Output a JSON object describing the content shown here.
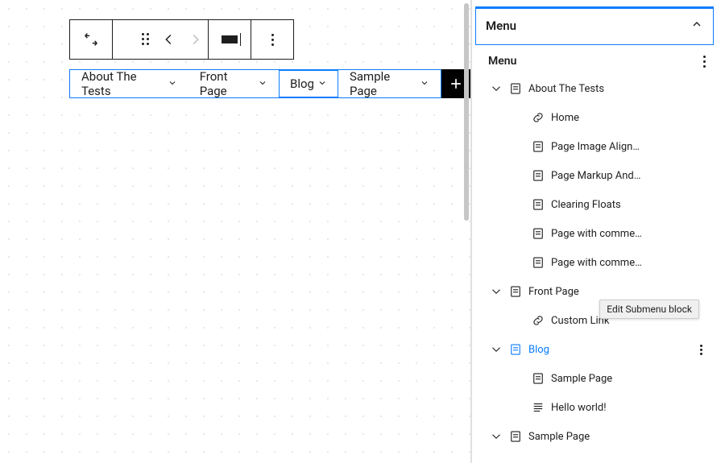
{
  "editor": {
    "nav_items": [
      {
        "label": "About The Tests",
        "selected": false
      },
      {
        "label": "Front Page",
        "selected": false
      },
      {
        "label": "Blog",
        "selected": true
      },
      {
        "label": "Sample Page",
        "selected": false
      }
    ]
  },
  "panel": {
    "title": "Menu",
    "subtitle": "Menu",
    "tooltip": "Edit Submenu block",
    "tree": [
      {
        "depth": 1,
        "icon": "page",
        "label": "About The Tests",
        "twisty": true,
        "active": false,
        "opts": false
      },
      {
        "depth": 2,
        "icon": "link",
        "label": "Home",
        "twisty": false,
        "active": false,
        "opts": false
      },
      {
        "depth": 2,
        "icon": "page",
        "label": "Page Image Align…",
        "twisty": false,
        "active": false,
        "opts": false
      },
      {
        "depth": 2,
        "icon": "page",
        "label": "Page Markup And…",
        "twisty": false,
        "active": false,
        "opts": false
      },
      {
        "depth": 2,
        "icon": "page",
        "label": "Clearing Floats",
        "twisty": false,
        "active": false,
        "opts": false
      },
      {
        "depth": 2,
        "icon": "page",
        "label": "Page with comme…",
        "twisty": false,
        "active": false,
        "opts": false
      },
      {
        "depth": 2,
        "icon": "page",
        "label": "Page with comme…",
        "twisty": false,
        "active": false,
        "opts": false
      },
      {
        "depth": 1,
        "icon": "page",
        "label": "Front Page",
        "twisty": true,
        "active": false,
        "opts": false
      },
      {
        "depth": 2,
        "icon": "link",
        "label": "Custom Link",
        "twisty": false,
        "active": false,
        "opts": false
      },
      {
        "depth": 1,
        "icon": "page",
        "label": "Blog",
        "twisty": true,
        "active": true,
        "opts": true
      },
      {
        "depth": 2,
        "icon": "page",
        "label": "Sample Page",
        "twisty": false,
        "active": false,
        "opts": false
      },
      {
        "depth": 2,
        "icon": "post",
        "label": "Hello world!",
        "twisty": false,
        "active": false,
        "opts": false
      },
      {
        "depth": 1,
        "icon": "page",
        "label": "Sample Page",
        "twisty": true,
        "active": false,
        "opts": false
      }
    ]
  }
}
